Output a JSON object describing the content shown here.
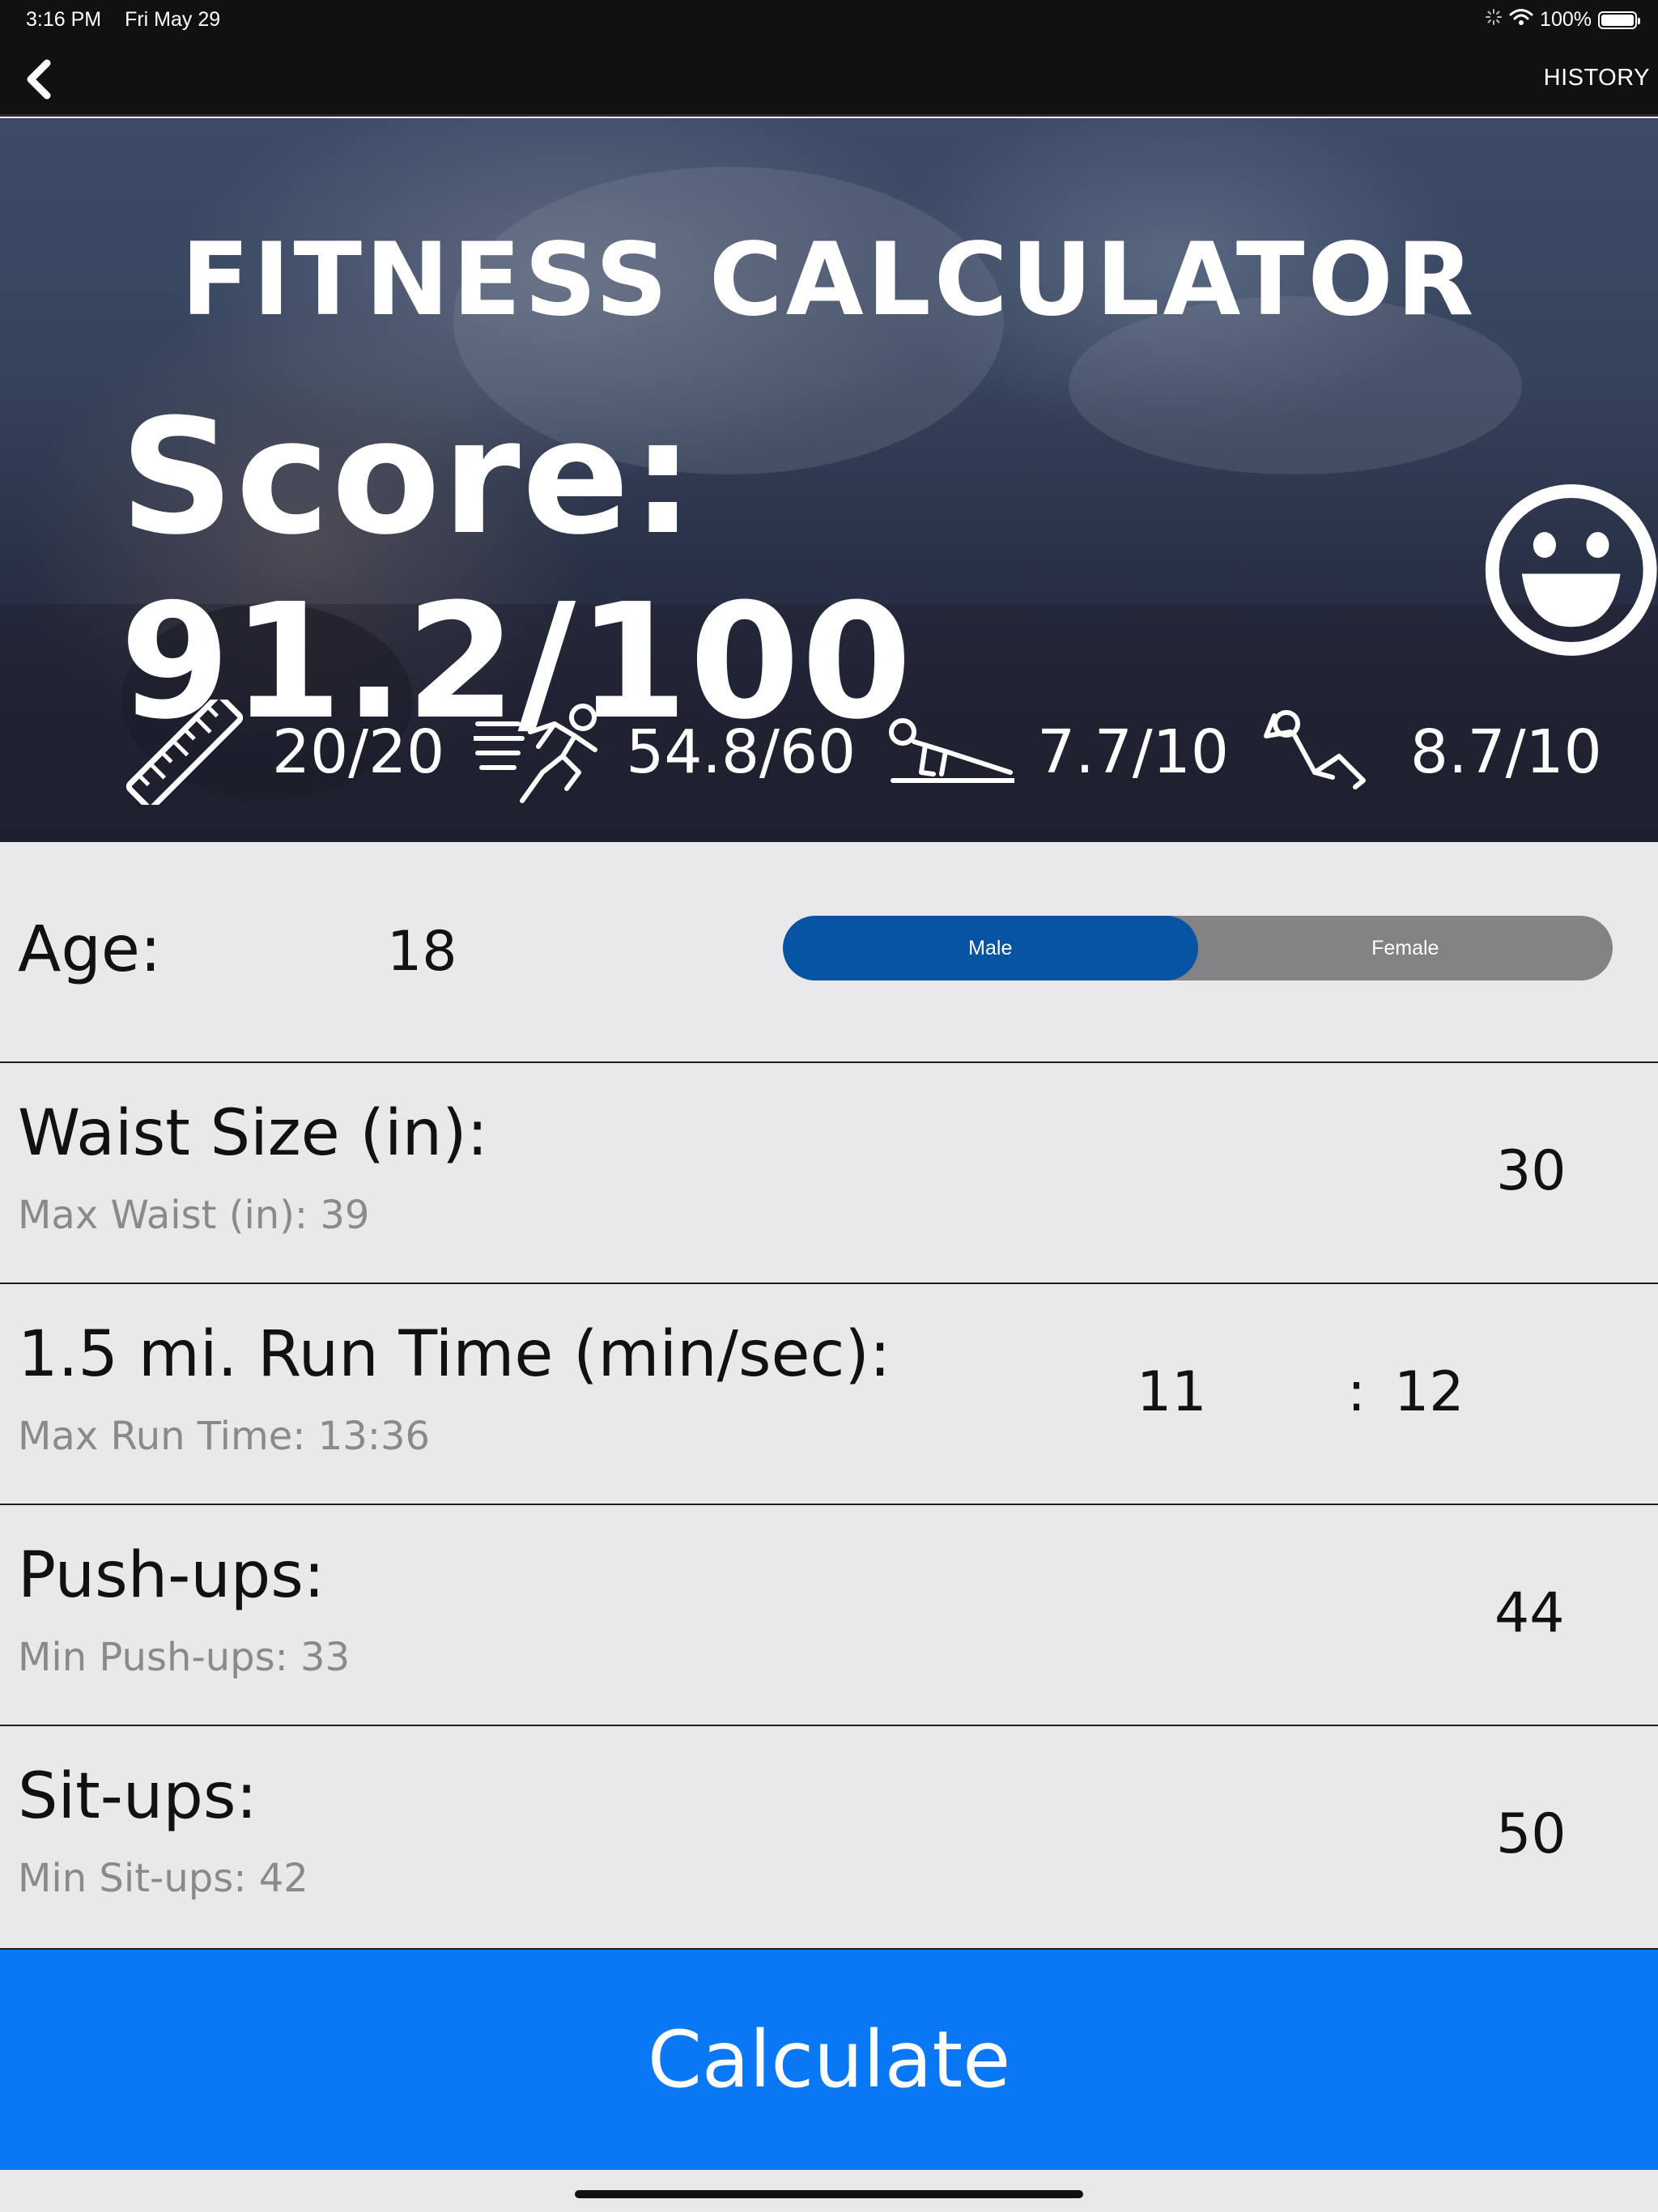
{
  "status": {
    "time": "3:16 PM",
    "date": "Fri May 29",
    "battery": "100%"
  },
  "nav": {
    "history_label": "HISTORY"
  },
  "hero": {
    "title": "FITNESS CALCULATOR",
    "score": "Score: 91.2/100",
    "stats": [
      {
        "icon": "ruler-icon",
        "value": "20/20"
      },
      {
        "icon": "runner-icon",
        "value": "54.8/60"
      },
      {
        "icon": "pushup-icon",
        "value": "7.7/10"
      },
      {
        "icon": "situp-icon",
        "value": "8.7/10"
      }
    ]
  },
  "age": {
    "label": "Age:",
    "value": "18"
  },
  "gender": {
    "options": [
      "Male",
      "Female"
    ],
    "selected": "Male"
  },
  "waist": {
    "label": "Waist Size (in):",
    "sub": "Max Waist (in): 39",
    "value": "30"
  },
  "run": {
    "label": "1.5 mi. Run Time (min/sec):",
    "sub": "Max Run Time: 13:36",
    "minutes": "11",
    "separator": ":",
    "seconds": "12"
  },
  "pushups": {
    "label": "Push-ups:",
    "sub": "Min Push-ups: 33",
    "value": "44"
  },
  "situps": {
    "label": "Sit-ups:",
    "sub": "Min Sit-ups: 42",
    "value": "50"
  },
  "calculate_label": "Calculate",
  "colors": {
    "accent": "#0a77f5",
    "segment_active": "#0654a3",
    "segment_bg": "#838385"
  }
}
